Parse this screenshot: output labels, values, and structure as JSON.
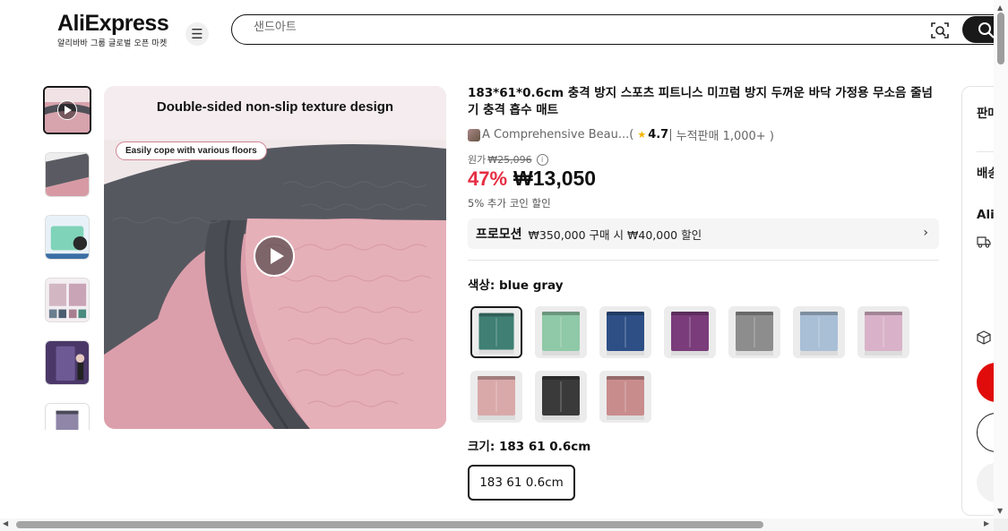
{
  "header": {
    "logo_text": "AliExpress",
    "logo_sub": "알리바바 그룹 글로벌 오픈 마켓",
    "search_placeholder": "샌드아트"
  },
  "product": {
    "title": "183*61*0.6cm 충격 방지 스포츠 피트니스 미끄럼 방지 두꺼운 바닥 가정용 무소음 줄넘기 충격 흡수 매트",
    "store_name": "A Comprehensive Beau...",
    "rating_open": " ( ",
    "rating": "4.7",
    "separator": " | ",
    "sold": "누적판매 1,000+ )",
    "original_label": "원가",
    "original_price": "₩25,096",
    "discount": "47%",
    "price": "₩13,050",
    "coin_text": "5% 추가 코인 할인",
    "promo_label": "프로모션",
    "promo_text": "₩350,000 구매 시 ₩40,000 할인",
    "color_label": "색상: blue gray",
    "size_label": "크기:  183 61 0.6cm",
    "size_option": "183 61 0.6cm"
  },
  "image": {
    "headline": "Double-sided non-slip texture design",
    "pill": "Easily cope with various floors"
  },
  "swatches": [
    {
      "name": "blue gray",
      "mat": "#3f7f74",
      "selected": true
    },
    {
      "name": "mint",
      "mat": "#8fc9a7",
      "selected": false
    },
    {
      "name": "navy",
      "mat": "#2d4f86",
      "selected": false
    },
    {
      "name": "purple",
      "mat": "#7a3c7a",
      "selected": false
    },
    {
      "name": "gray",
      "mat": "#8d8d8d",
      "selected": false
    },
    {
      "name": "light blue",
      "mat": "#a8bfd6",
      "selected": false
    },
    {
      "name": "pink purple",
      "mat": "#d9b2c9",
      "selected": false
    },
    {
      "name": "pink",
      "mat": "#d9a9a9",
      "selected": false
    },
    {
      "name": "black",
      "mat": "#3a3a3a",
      "selected": false
    },
    {
      "name": "rose",
      "mat": "#c98c8c",
      "selected": false
    }
  ],
  "side_panel": {
    "seller_label": "판매",
    "shipping_label": "배송",
    "brand_label": "Ali"
  },
  "colors": {
    "sale_red": "#e62e43",
    "buy_red": "#e00b0b",
    "text_dark": "#191919"
  }
}
